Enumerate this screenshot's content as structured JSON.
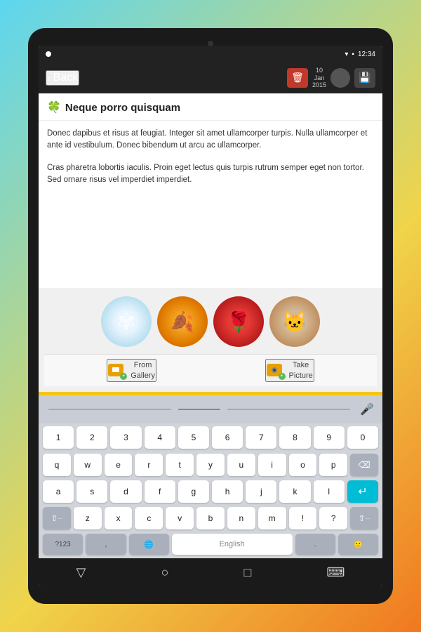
{
  "status_bar": {
    "time": "12:34",
    "wifi": "▾",
    "battery": "🔋"
  },
  "app_bar": {
    "back_label": "Back",
    "date": {
      "day": "10",
      "month": "Jan",
      "year": "2015"
    },
    "trash_icon": "🗑",
    "save_icon": "💾"
  },
  "note": {
    "title": "Neque porro quisquam",
    "clover": "🍀",
    "paragraph1": "Donec dapibus et risus at feugiat. Integer sit amet ullamcorper turpis. Nulla ullamcorper et ante id vestibulum. Donec bibendum ut arcu ac ullamcorper.",
    "paragraph2": "Cras pharetra lobortis iaculis. Proin eget lectus quis turpis rutrum semper eget non tortor. Sed ornare risus vel imperdiet imperdiet."
  },
  "images": [
    {
      "id": "dandelion",
      "emoji": "🌬",
      "alt": "dandelion"
    },
    {
      "id": "autumn",
      "emoji": "🍂",
      "alt": "autumn leaves"
    },
    {
      "id": "rose",
      "emoji": "🌹",
      "alt": "red rose"
    },
    {
      "id": "cat",
      "emoji": "🐱",
      "alt": "kitten"
    }
  ],
  "gallery_actions": {
    "from_gallery": "From\nGallery",
    "take_picture": "Take\nPicture"
  },
  "keyboard": {
    "rows": {
      "numbers": [
        "1",
        "2",
        "3",
        "4",
        "5",
        "6",
        "7",
        "8",
        "9",
        "0"
      ],
      "row1": [
        "q",
        "w",
        "e",
        "r",
        "t",
        "y",
        "u",
        "i",
        "o",
        "p"
      ],
      "row2": [
        "a",
        "s",
        "d",
        "f",
        "g",
        "h",
        "j",
        "k",
        "l"
      ],
      "row3": [
        "z",
        "x",
        "c",
        "v",
        "b",
        "n",
        "m",
        "!",
        "?"
      ],
      "bottom": [
        "?123",
        ",",
        "globe",
        "English",
        ".",
        "emoji"
      ]
    },
    "mic_icon": "🎤",
    "backspace": "⌫",
    "enter": "↵",
    "shift": "⇧"
  },
  "nav_bar": {
    "back_icon": "▽",
    "home_icon": "○",
    "recent_icon": "□",
    "keyboard_icon": "⌨"
  }
}
